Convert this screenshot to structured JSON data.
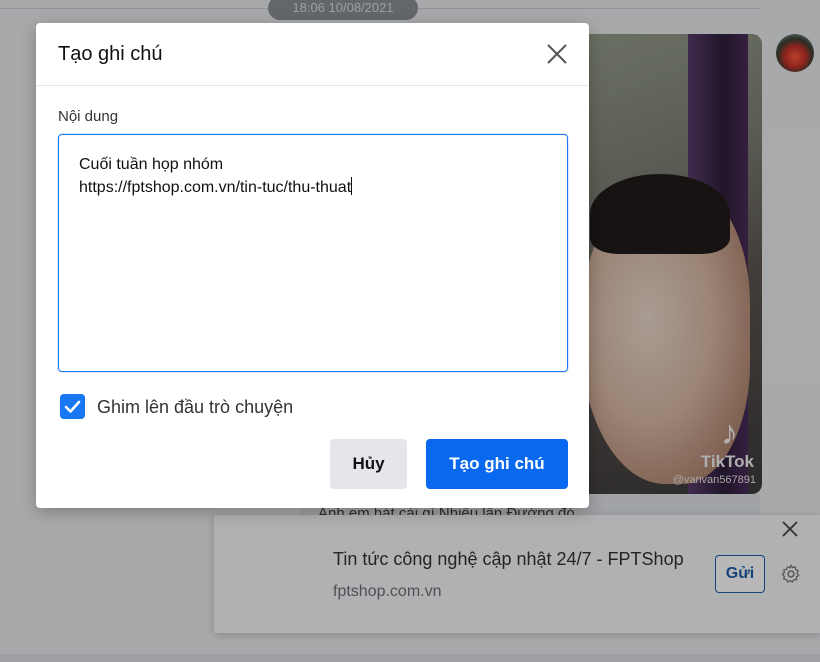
{
  "background": {
    "timestamp": "18:06 10/08/2021",
    "caption": "Anh em hát cái gì Nhiều lần Đường đó",
    "tiktok": {
      "logo": "TikTok",
      "username": "@vanvan567891"
    }
  },
  "modal": {
    "title": "Tạo ghi chú",
    "field_label": "Nội dung",
    "content": "Cuối tuần họp nhóm\nhttps://fptshop.com.vn/tin-tuc/thu-thuat",
    "pin_label": "Ghim lên đầu trò chuyện",
    "pin_checked": true,
    "cancel_label": "Hủy",
    "create_label": "Tạo ghi chú",
    "accent_color": "#0868f0"
  },
  "notification": {
    "title": "Tin tức công nghệ cập nhật 24/7 - FPTShop",
    "site": "fptshop.com.vn",
    "send_label": "Gửi"
  }
}
